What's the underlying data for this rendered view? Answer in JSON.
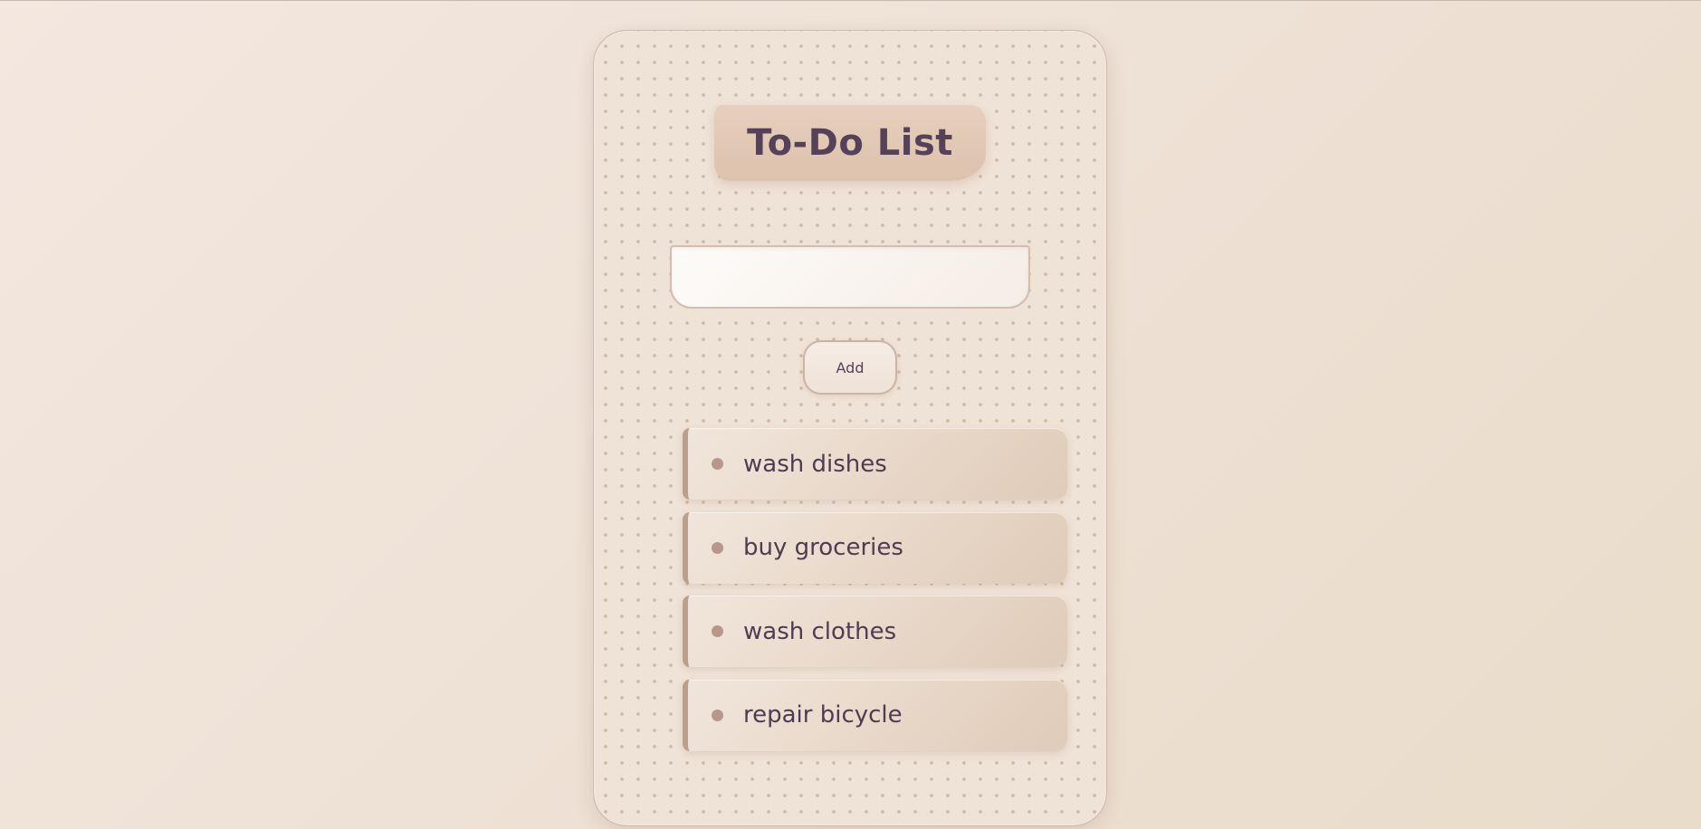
{
  "app": {
    "title": "To-Do List"
  },
  "input": {
    "value": "",
    "placeholder": ""
  },
  "add_button": {
    "label": "Add"
  },
  "todos": [
    {
      "text": "wash dishes",
      "icon": "bullet-dot-icon"
    },
    {
      "text": "buy groceries",
      "icon": "bullet-dot-icon"
    },
    {
      "text": "wash clothes",
      "icon": "bullet-dot-icon"
    },
    {
      "text": "repair bicycle",
      "icon": "bullet-dot-icon"
    }
  ],
  "colors": {
    "background": "#efe2d6",
    "title_banner": "#e2c9b5",
    "text": "#564258",
    "item_accent": "#bb9e8b",
    "bullet": "#b7978a"
  }
}
